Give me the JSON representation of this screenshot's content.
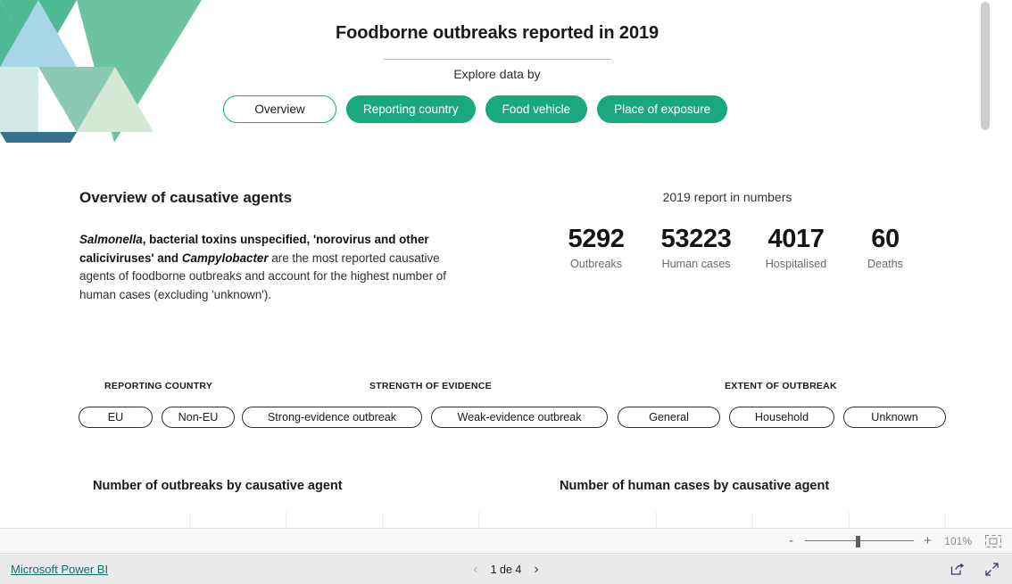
{
  "header": {
    "title": "Foodborne outbreaks reported in 2019",
    "explore_label": "Explore data by",
    "nav_pills": [
      {
        "label": "Overview",
        "state": "active"
      },
      {
        "label": "Reporting country",
        "state": "filled"
      },
      {
        "label": "Food vehicle",
        "state": "filled"
      },
      {
        "label": "Place of exposure",
        "state": "filled"
      }
    ]
  },
  "overview": {
    "heading": "Overview of causative agents",
    "paragraph_parts": {
      "p1": "Salmonella",
      "p2": ", bacterial toxins unspecified, 'norovirus and other caliciviruses' and ",
      "p3": "Campylobacter",
      "p4": " are the most reported causative agents of foodborne outbreaks and account for the highest number of human cases (excluding 'unknown')."
    }
  },
  "kpis": {
    "caption": "2019 report in numbers",
    "items": [
      {
        "value": "5292",
        "label": "Outbreaks"
      },
      {
        "value": "53223",
        "label": "Human cases"
      },
      {
        "value": "4017",
        "label": "Hospitalised"
      },
      {
        "value": "60",
        "label": "Deaths"
      }
    ]
  },
  "slicers": [
    {
      "title": "REPORTING COUNTRY",
      "options": [
        "EU",
        "Non-EU"
      ]
    },
    {
      "title": "STRENGTH OF EVIDENCE",
      "options": [
        "Strong-evidence outbreak",
        "Weak-evidence outbreak"
      ]
    },
    {
      "title": "EXTENT OF OUTBREAK",
      "options": [
        "General",
        "Household",
        "Unknown"
      ]
    }
  ],
  "charts": [
    {
      "title": "Number of outbreaks by causative agent"
    },
    {
      "title": "Number of human cases by causative agent"
    }
  ],
  "chart_data": [
    {
      "type": "bar",
      "title": "Number of outbreaks by causative agent",
      "categories": [],
      "values": [],
      "xlabel": "",
      "ylabel": "",
      "note": "Chart body is below the visible viewport; only the title and faint gridline tops are rendered."
    },
    {
      "type": "bar",
      "title": "Number of human cases by causative agent",
      "categories": [],
      "values": [],
      "xlabel": "",
      "ylabel": "",
      "note": "Chart body is below the visible viewport; only the title and faint gridline tops are rendered."
    }
  ],
  "zoom_bar": {
    "minus": "-",
    "plus": "+",
    "percent": "101%"
  },
  "status_bar": {
    "brand": "Microsoft Power BI",
    "pager_text": "1 de 4",
    "prev_arrow": "‹",
    "next_arrow": "›"
  },
  "colors": {
    "accent_teal": "#1aa87f",
    "accent_border": "#17a57e",
    "brand_link": "#13706a",
    "art_green": "#6cc3a1",
    "art_green_dark": "#4fb894",
    "art_blue_light": "#a9d6e5",
    "art_mint": "#8cc9b4",
    "art_pale_green": "#d5e7d5",
    "art_pale_blue": "#d3e9e6",
    "art_teal_dark": "#35728c"
  }
}
